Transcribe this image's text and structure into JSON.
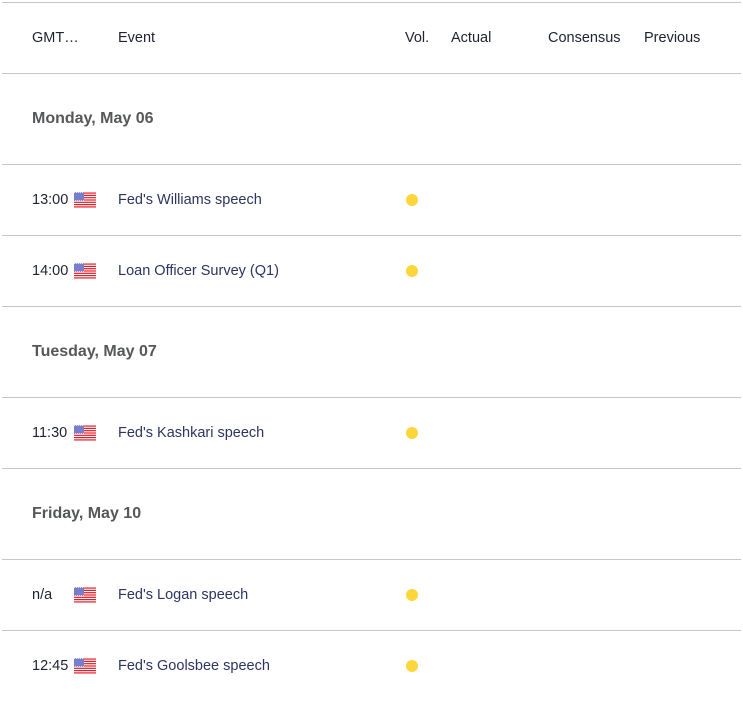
{
  "header": {
    "gmt": "GMT…",
    "event": "Event",
    "vol": "Vol.",
    "actual": "Actual",
    "consensus": "Consensus",
    "previous": "Previous"
  },
  "colors": {
    "volatility_low": "#fdd63b",
    "event_text": "#2c3561",
    "divider": "#c4c8c8"
  },
  "groups": [
    {
      "day": "Monday, May 06",
      "events": [
        {
          "time": "13:00",
          "country_icon": "us-flag-icon",
          "event": "Fed's Williams speech",
          "volatility": "low",
          "actual": "",
          "consensus": "",
          "previous": ""
        },
        {
          "time": "14:00",
          "country_icon": "us-flag-icon",
          "event": "Loan Officer Survey (Q1)",
          "volatility": "low",
          "actual": "",
          "consensus": "",
          "previous": ""
        }
      ]
    },
    {
      "day": "Tuesday, May 07",
      "events": [
        {
          "time": "11:30",
          "country_icon": "us-flag-icon",
          "event": "Fed's Kashkari speech",
          "volatility": "low",
          "actual": "",
          "consensus": "",
          "previous": ""
        }
      ]
    },
    {
      "day": "Friday, May 10",
      "events": [
        {
          "time": "n/a",
          "country_icon": "us-flag-icon",
          "event": "Fed's Logan speech",
          "volatility": "low",
          "actual": "",
          "consensus": "",
          "previous": ""
        },
        {
          "time": "12:45",
          "country_icon": "us-flag-icon",
          "event": "Fed's Goolsbee speech",
          "volatility": "low",
          "actual": "",
          "consensus": "",
          "previous": ""
        }
      ]
    }
  ]
}
